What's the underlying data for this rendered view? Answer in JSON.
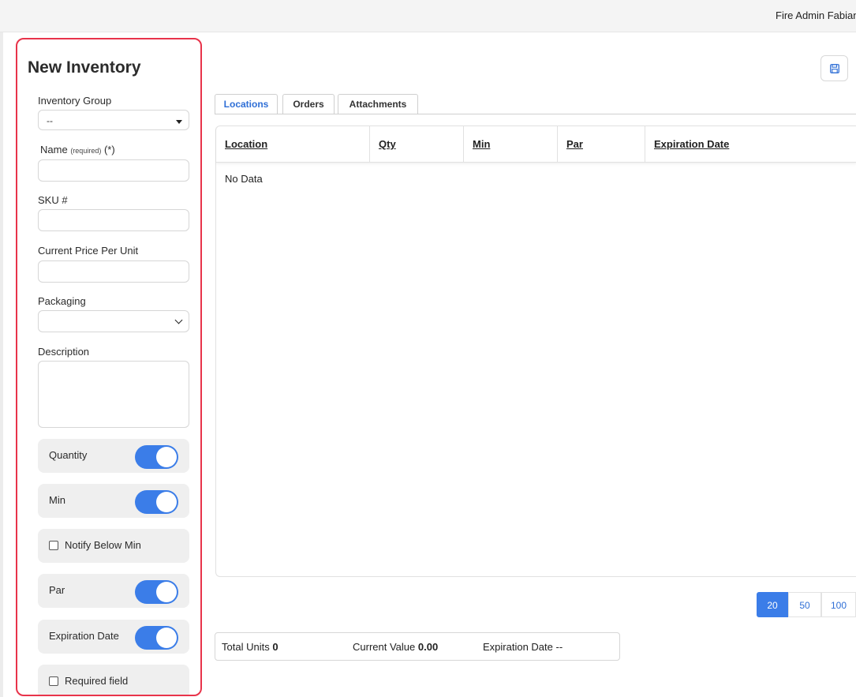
{
  "header": {
    "user_name": "Fire Admin Fabian"
  },
  "form": {
    "title": "New Inventory",
    "inventory_group": {
      "label": "Inventory Group",
      "value": "--"
    },
    "name": {
      "label": "Name",
      "required_note": "(required)",
      "required_mark": "(*)",
      "value": ""
    },
    "sku": {
      "label": "SKU #",
      "value": ""
    },
    "price": {
      "label": "Current Price Per Unit",
      "value": ""
    },
    "packaging": {
      "label": "Packaging",
      "value": ""
    },
    "description": {
      "label": "Description",
      "value": ""
    },
    "toggles": {
      "quantity": {
        "label": "Quantity",
        "on": true
      },
      "min": {
        "label": "Min",
        "on": true
      },
      "par": {
        "label": "Par",
        "on": true
      },
      "expiration": {
        "label": "Expiration Date",
        "on": true
      }
    },
    "checkboxes": {
      "notify_below_min": {
        "label": "Notify Below Min",
        "checked": false
      },
      "required_field": {
        "label": "Required field",
        "checked": false
      }
    }
  },
  "tabs": [
    {
      "label": "Locations",
      "active": true
    },
    {
      "label": "Orders",
      "active": false
    },
    {
      "label": "Attachments",
      "active": false
    }
  ],
  "grid": {
    "columns": [
      "Location",
      "Qty",
      "Min",
      "Par",
      "Expiration Date"
    ],
    "empty_text": "No Data"
  },
  "pager": {
    "sizes": [
      "20",
      "50",
      "100"
    ],
    "selected": "20"
  },
  "summary": {
    "total_units_label": "Total Units",
    "total_units_value": "0",
    "current_value_label": "Current Value",
    "current_value_value": "0.00",
    "expiration_label": "Expiration Date",
    "expiration_value": "--"
  },
  "icons": {
    "save": "save-floppy-icon"
  },
  "colors": {
    "accent": "#3b7de8",
    "panel_border": "#e8334a",
    "link": "#2f6fd6"
  }
}
